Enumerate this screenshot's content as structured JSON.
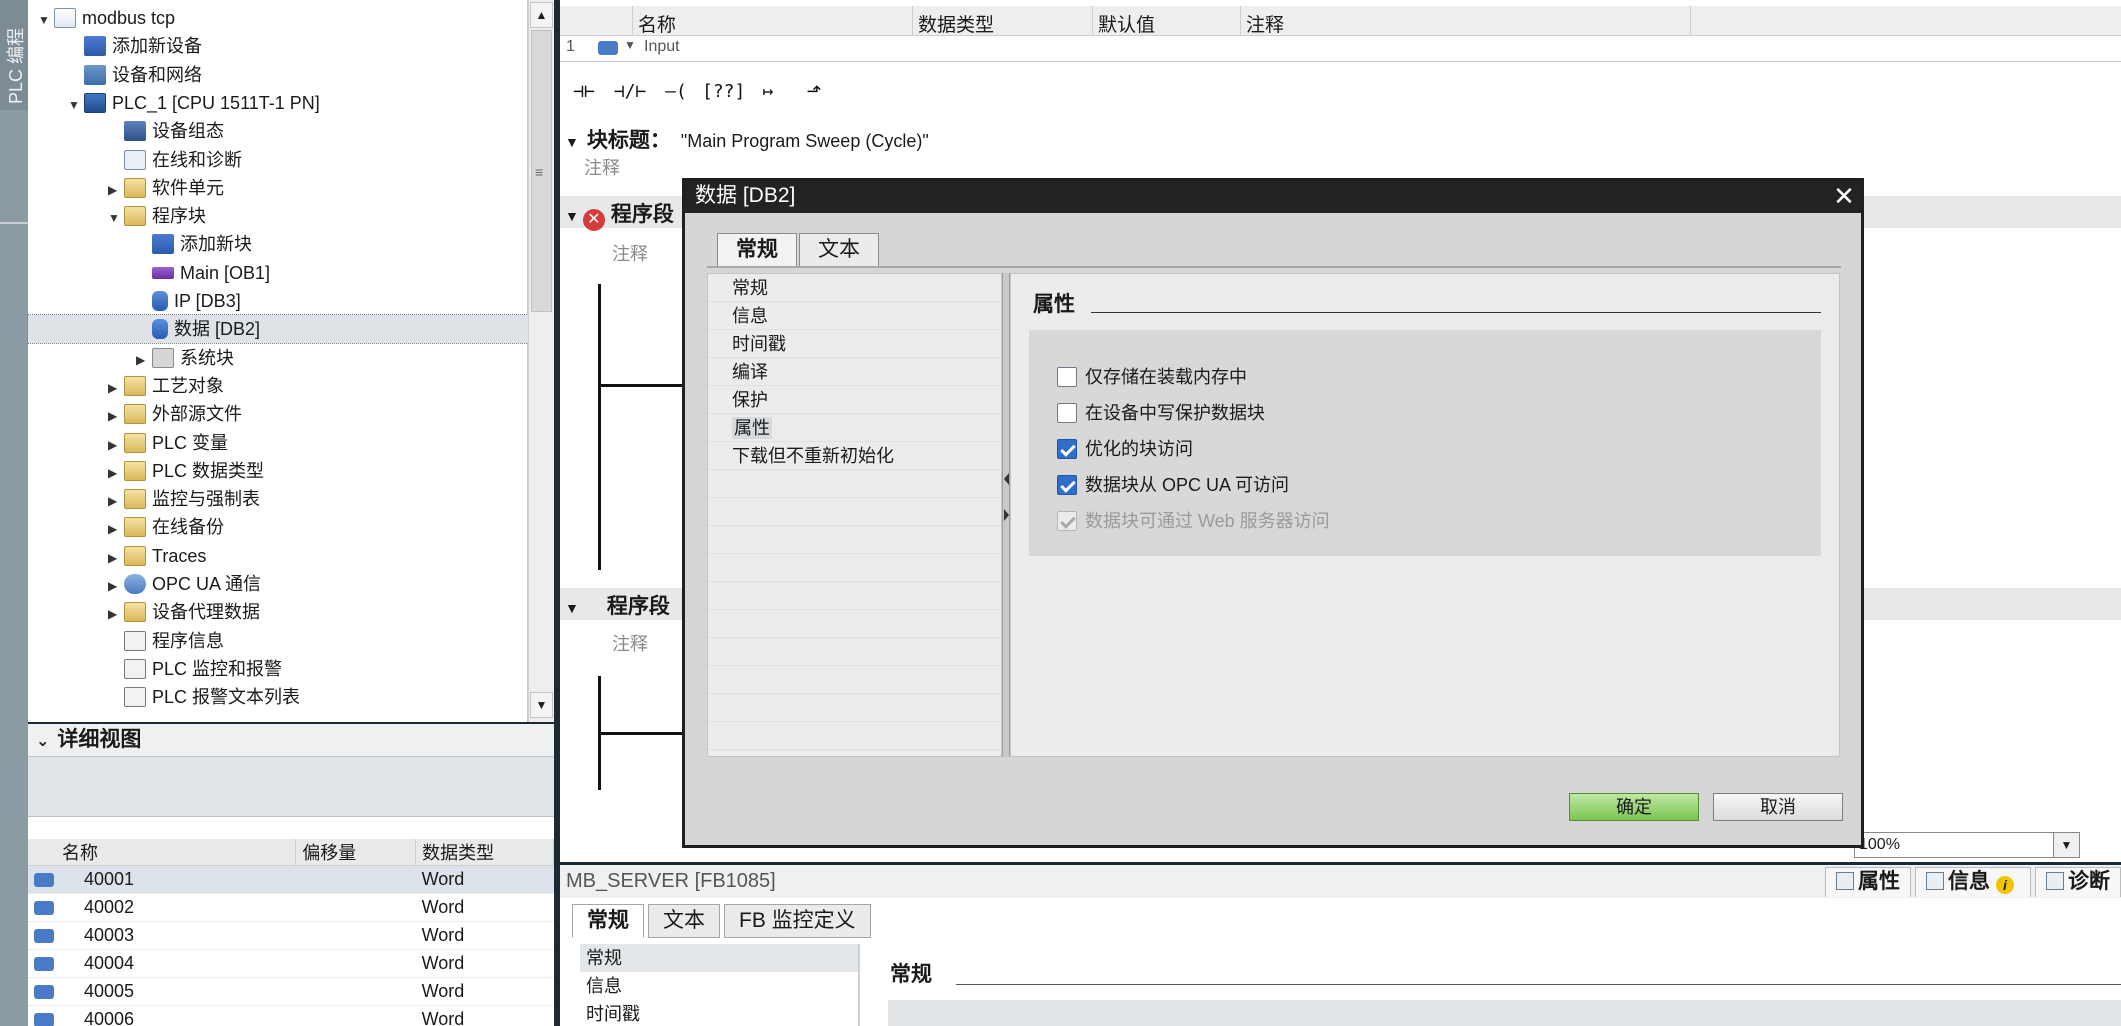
{
  "side_strip": {
    "label": "PLC 编程"
  },
  "tree": {
    "items": [
      {
        "label": "modbus tcp",
        "depth": 0,
        "toggle": "▼",
        "icon": "project-icon",
        "iconclass": "doc"
      },
      {
        "label": "添加新设备",
        "depth": 1,
        "toggle": "",
        "icon": "add-device-icon",
        "iconclass": "add"
      },
      {
        "label": "设备和网络",
        "depth": 1,
        "toggle": "",
        "icon": "network-icon",
        "iconclass": "net"
      },
      {
        "label": "PLC_1 [CPU 1511T-1 PN]",
        "depth": 1,
        "toggle": "▼",
        "icon": "cpu-icon",
        "iconclass": "cpu"
      },
      {
        "label": "设备组态",
        "depth": 2,
        "toggle": "",
        "icon": "device-config-icon",
        "iconclass": "cfg"
      },
      {
        "label": "在线和诊断",
        "depth": 2,
        "toggle": "",
        "icon": "online-diagnostics-icon",
        "iconclass": "diag"
      },
      {
        "label": "软件单元",
        "depth": 2,
        "toggle": "▶",
        "icon": "software-units-icon",
        "iconclass": "fold"
      },
      {
        "label": "程序块",
        "depth": 2,
        "toggle": "▼",
        "icon": "program-blocks-icon",
        "iconclass": "fold"
      },
      {
        "label": "添加新块",
        "depth": 3,
        "toggle": "",
        "icon": "add-block-icon",
        "iconclass": "add"
      },
      {
        "label": "Main [OB1]",
        "depth": 3,
        "toggle": "",
        "icon": "ob-icon",
        "iconclass": "ob"
      },
      {
        "label": "IP [DB3]",
        "depth": 3,
        "toggle": "",
        "icon": "db-icon",
        "iconclass": "db"
      },
      {
        "label": "数据 [DB2]",
        "depth": 3,
        "toggle": "",
        "icon": "db-icon",
        "iconclass": "db",
        "selected": true
      },
      {
        "label": "系统块",
        "depth": 3,
        "toggle": "▶",
        "icon": "system-blocks-icon",
        "iconclass": "sys"
      },
      {
        "label": "工艺对象",
        "depth": 2,
        "toggle": "▶",
        "icon": "technology-objects-icon",
        "iconclass": "fold"
      },
      {
        "label": "外部源文件",
        "depth": 2,
        "toggle": "▶",
        "icon": "external-sources-icon",
        "iconclass": "fold"
      },
      {
        "label": "PLC 变量",
        "depth": 2,
        "toggle": "▶",
        "icon": "plc-tags-icon",
        "iconclass": "fold"
      },
      {
        "label": "PLC 数据类型",
        "depth": 2,
        "toggle": "▶",
        "icon": "plc-datatypes-icon",
        "iconclass": "fold"
      },
      {
        "label": "监控与强制表",
        "depth": 2,
        "toggle": "▶",
        "icon": "watch-tables-icon",
        "iconclass": "fold"
      },
      {
        "label": "在线备份",
        "depth": 2,
        "toggle": "▶",
        "icon": "online-backup-icon",
        "iconclass": "fold"
      },
      {
        "label": "Traces",
        "depth": 2,
        "toggle": "▶",
        "icon": "traces-icon",
        "iconclass": "fold"
      },
      {
        "label": "OPC UA 通信",
        "depth": 2,
        "toggle": "▶",
        "icon": "opc-ua-icon",
        "iconclass": "opc"
      },
      {
        "label": "设备代理数据",
        "depth": 2,
        "toggle": "▶",
        "icon": "device-proxy-icon",
        "iconclass": "fold"
      },
      {
        "label": "程序信息",
        "depth": 2,
        "toggle": "",
        "icon": "program-info-icon",
        "iconclass": "info"
      },
      {
        "label": "PLC 监控和报警",
        "depth": 2,
        "toggle": "",
        "icon": "plc-alarms-icon",
        "iconclass": "info"
      },
      {
        "label": "PLC 报警文本列表",
        "depth": 2,
        "toggle": "",
        "icon": "alarm-text-icon",
        "iconclass": "info"
      }
    ]
  },
  "detail_view": {
    "title": "详细视图",
    "columns": [
      "名称",
      "偏移量",
      "数据类型"
    ],
    "rows": [
      {
        "name": "40001",
        "offset": "",
        "type": "Word"
      },
      {
        "name": "40002",
        "offset": "",
        "type": "Word"
      },
      {
        "name": "40003",
        "offset": "",
        "type": "Word"
      },
      {
        "name": "40004",
        "offset": "",
        "type": "Word"
      },
      {
        "name": "40005",
        "offset": "",
        "type": "Word"
      },
      {
        "name": "40006",
        "offset": "",
        "type": "Word"
      }
    ]
  },
  "interface": {
    "columns": [
      "名称",
      "数据类型",
      "默认值",
      "注释"
    ],
    "row1": {
      "index": "1",
      "name": "Input"
    }
  },
  "toolbar": {
    "buttons": [
      {
        "name": "no-contact-button",
        "label": "⊣⊢"
      },
      {
        "name": "nc-contact-button",
        "label": "⊣/⊢"
      },
      {
        "name": "coil-button",
        "label": "–( )–"
      },
      {
        "name": "empty-box-button",
        "label": "[??]"
      },
      {
        "name": "open-branch-button",
        "label": "↦"
      },
      {
        "name": "close-branch-button",
        "label": "⬏"
      }
    ]
  },
  "editor": {
    "block_title_label": "块标题：",
    "block_title_value": "\"Main Program Sweep (Cycle)\"",
    "comment": "注释",
    "network1_label": "程序段",
    "network2_label": "程序段",
    "zoom": "100%"
  },
  "inspector": {
    "title": "MB_SERVER [FB1085]",
    "right_tabs": [
      "属性",
      "信息",
      "诊断"
    ],
    "tabs": [
      "常规",
      "文本",
      "FB 监控定义"
    ],
    "nav": [
      "常规",
      "信息",
      "时间戳"
    ],
    "section": "常规"
  },
  "dialog": {
    "title": "数据 [DB2]",
    "tabs": [
      "常规",
      "文本"
    ],
    "nav": [
      "常规",
      "信息",
      "时间戳",
      "编译",
      "保护",
      "属性",
      "下载但不重新初始化"
    ],
    "active_nav_index": 5,
    "section": "属性",
    "options": [
      {
        "label": "仅存储在装载内存中",
        "checked": false,
        "disabled": false
      },
      {
        "label": "在设备中写保护数据块",
        "checked": false,
        "disabled": false
      },
      {
        "label": "优化的块访问",
        "checked": true,
        "disabled": false
      },
      {
        "label": "数据块从 OPC UA 可访问",
        "checked": true,
        "disabled": false
      },
      {
        "label": "数据块可通过 Web 服务器访问",
        "checked": true,
        "disabled": true
      }
    ],
    "ok_label": "确定",
    "cancel_label": "取消"
  }
}
